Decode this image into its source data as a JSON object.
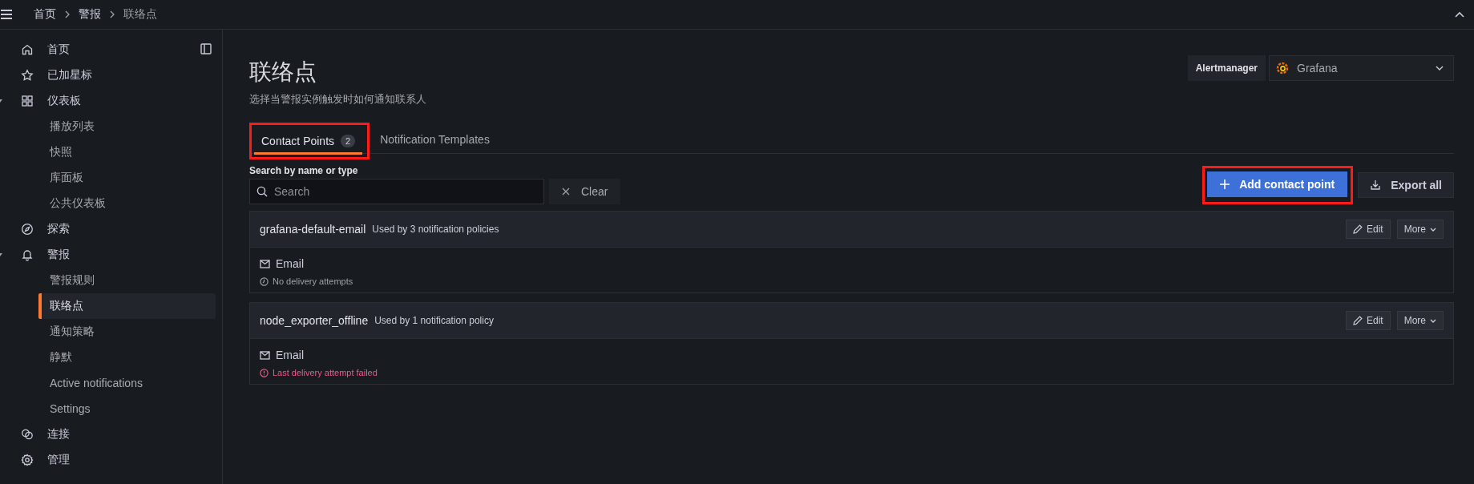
{
  "breadcrumbs": [
    {
      "label": "首页",
      "current": false
    },
    {
      "label": "警报",
      "current": false
    },
    {
      "label": "联络点",
      "current": true
    }
  ],
  "sidebar": {
    "items": [
      {
        "label": "首页",
        "selected": false
      },
      {
        "label": "已加星标",
        "selected": false
      },
      {
        "label": "仪表板",
        "selected": false,
        "expanded": true,
        "children": [
          {
            "label": "播放列表",
            "selected": false
          },
          {
            "label": "快照",
            "selected": false
          },
          {
            "label": "库面板",
            "selected": false
          },
          {
            "label": "公共仪表板",
            "selected": false
          }
        ]
      },
      {
        "label": "探索",
        "selected": false
      },
      {
        "label": "警报",
        "selected": false,
        "expanded": true,
        "children": [
          {
            "label": "警报规则",
            "selected": false
          },
          {
            "label": "联络点",
            "selected": true
          },
          {
            "label": "通知策略",
            "selected": false
          },
          {
            "label": "静默",
            "selected": false
          },
          {
            "label": "Active notifications",
            "selected": false
          },
          {
            "label": "Settings",
            "selected": false
          }
        ]
      },
      {
        "label": "连接",
        "selected": false
      },
      {
        "label": "管理",
        "selected": false
      }
    ]
  },
  "page": {
    "title": "联络点",
    "subtitle": "选择当警报实例触发时如何通知联系人"
  },
  "alertmanager": {
    "label": "Alertmanager",
    "value": "Grafana"
  },
  "tabs": [
    {
      "label": "Contact Points",
      "count": "2",
      "selected": true,
      "highlighted": true
    },
    {
      "label": "Notification Templates",
      "selected": false,
      "highlighted": false
    }
  ],
  "search": {
    "label": "Search by name or type",
    "placeholder": "Search",
    "clear": "Clear"
  },
  "actions": {
    "add": {
      "label": "Add contact point",
      "highlighted": true
    },
    "export": "Export all"
  },
  "contact_points": [
    {
      "name": "grafana-default-email",
      "usage": "Used by 3 notification policies",
      "edit": "Edit",
      "more": "More",
      "integration": "Email",
      "status": "No delivery attempts",
      "kind": "none"
    },
    {
      "name": "node_exporter_offline",
      "usage": "Used by 1 notification policy",
      "edit": "Edit",
      "more": "More",
      "integration": "Email",
      "status": "Last delivery attempt failed",
      "kind": "failed"
    }
  ]
}
